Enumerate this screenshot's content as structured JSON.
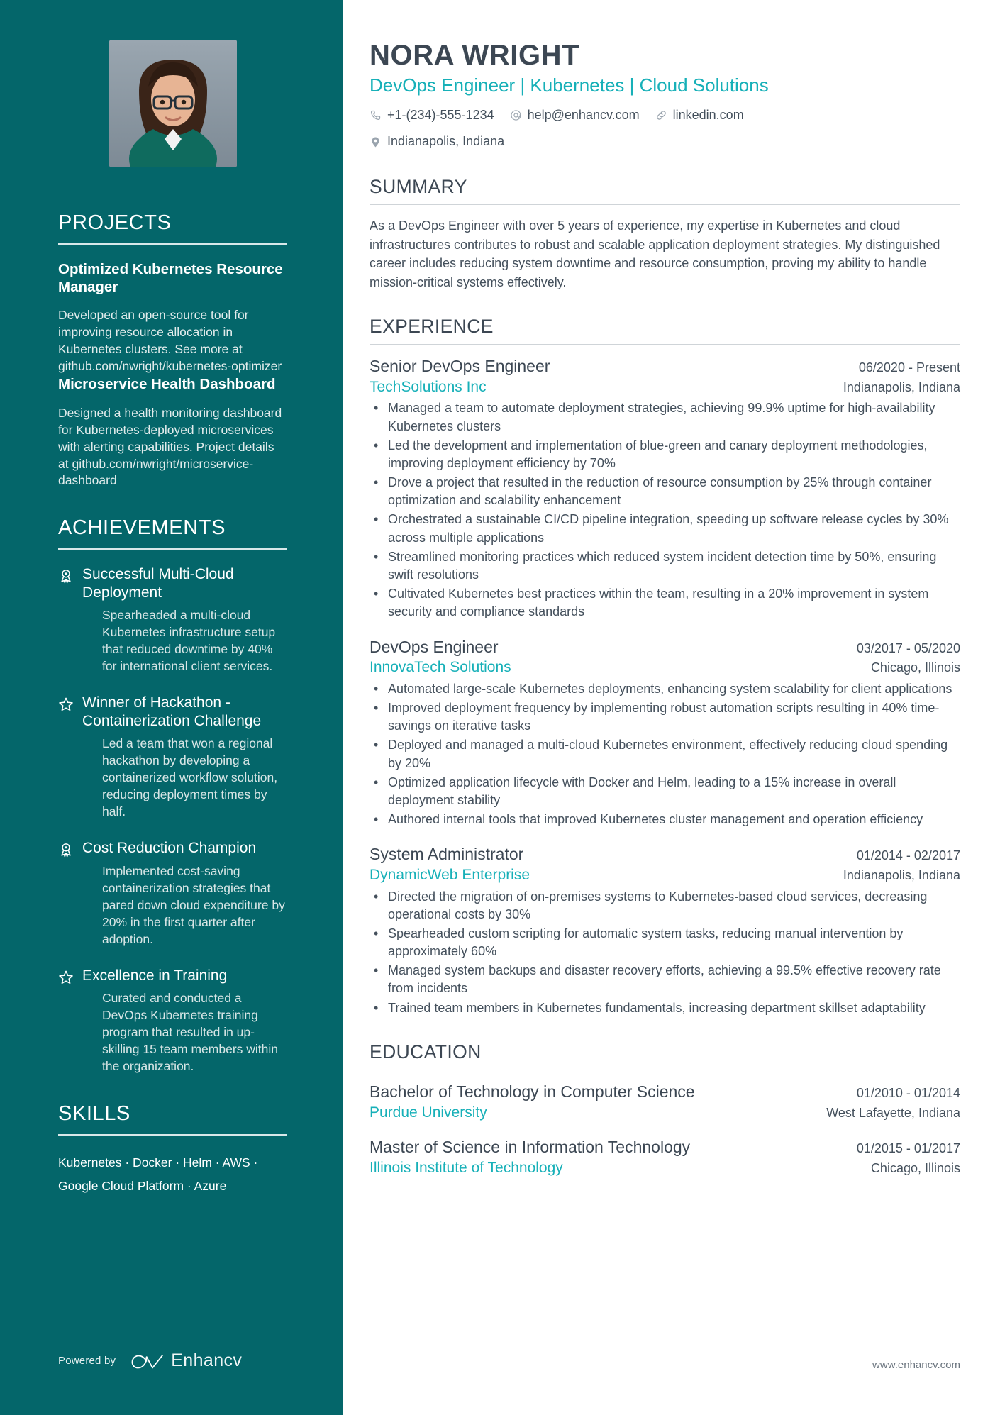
{
  "header": {
    "name": "NORA WRIGHT",
    "subtitle": "DevOps Engineer | Kubernetes | Cloud Solutions",
    "contacts": [
      {
        "icon": "phone-icon",
        "text": "+1-(234)-555-1234"
      },
      {
        "icon": "email-icon",
        "text": "help@enhancv.com"
      },
      {
        "icon": "link-icon",
        "text": "linkedin.com"
      },
      {
        "icon": "location-icon",
        "text": "Indianapolis, Indiana"
      }
    ]
  },
  "colors": {
    "sidebar_bg": "#04666a",
    "accent_teal": "#17b0b8",
    "heading_dark": "#3c4753",
    "body_text": "#44505c"
  },
  "sidebar": {
    "projects": {
      "heading": "PROJECTS",
      "items": [
        {
          "title": "Optimized Kubernetes Resource Manager",
          "description": "Developed an open-source tool for improving resource allocation in Kubernetes clusters. See more at github.com/nwright/kubernetes-optimizer"
        },
        {
          "title": "Microservice Health Dashboard",
          "description": "Designed a health monitoring dashboard for Kubernetes-deployed microservices with alerting capabilities. Project details at github.com/nwright/microservice-dashboard"
        }
      ]
    },
    "achievements": {
      "heading": "ACHIEVEMENTS",
      "items": [
        {
          "icon": "award-rosette-icon",
          "title": "Successful Multi-Cloud Deployment",
          "description": "Spearheaded a multi-cloud Kubernetes infrastructure setup that reduced downtime by 40% for international client services."
        },
        {
          "icon": "star-icon",
          "title": "Winner of Hackathon - Containerization Challenge",
          "description": "Led a team that won a regional hackathon by developing a containerized workflow solution, reducing deployment times by half."
        },
        {
          "icon": "award-rosette-icon",
          "title": "Cost Reduction Champion",
          "description": "Implemented cost-saving containerization strategies that pared down cloud expenditure by 20% in the first quarter after adoption."
        },
        {
          "icon": "star-icon",
          "title": "Excellence in Training",
          "description": "Curated and conducted a DevOps Kubernetes training program that resulted in up-skilling 15 team members within the organization."
        }
      ]
    },
    "skills": {
      "heading": "SKILLS",
      "lines": [
        "Kubernetes · Docker · Helm · AWS ·",
        "Google Cloud Platform · Azure"
      ]
    },
    "footer": {
      "powered_by": "Powered by",
      "brand": "Enhancv"
    }
  },
  "main": {
    "summary": {
      "heading": "SUMMARY",
      "text": "As a DevOps Engineer with over 5 years of experience, my expertise in Kubernetes and cloud infrastructures contributes to robust and scalable application deployment strategies. My distinguished career includes reducing system downtime and resource consumption, proving my ability to handle mission-critical systems effectively."
    },
    "experience": {
      "heading": "EXPERIENCE",
      "entries": [
        {
          "title": "Senior DevOps Engineer",
          "date": "06/2020 - Present",
          "company": "TechSolutions Inc",
          "location": "Indianapolis, Indiana",
          "bullets": [
            "Managed a team to automate deployment strategies, achieving 99.9% uptime for high-availability Kubernetes clusters",
            "Led the development and implementation of blue-green and canary deployment methodologies, improving deployment efficiency by 70%",
            "Drove a project that resulted in the reduction of resource consumption by 25% through container optimization and scalability enhancement",
            "Orchestrated a sustainable CI/CD pipeline integration, speeding up software release cycles by 30% across multiple applications",
            "Streamlined monitoring practices which reduced system incident detection time by 50%, ensuring swift resolutions",
            "Cultivated Kubernetes best practices within the team, resulting in a 20% improvement in system security and compliance standards"
          ]
        },
        {
          "title": "DevOps Engineer",
          "date": "03/2017 - 05/2020",
          "company": "InnovaTech Solutions",
          "location": "Chicago, Illinois",
          "bullets": [
            "Automated large-scale Kubernetes deployments, enhancing system scalability for client applications",
            "Improved deployment frequency by implementing robust automation scripts resulting in 40% time-savings on iterative tasks",
            "Deployed and managed a multi-cloud Kubernetes environment, effectively reducing cloud spending by 20%",
            "Optimized application lifecycle with Docker and Helm, leading to a 15% increase in overall deployment stability",
            "Authored internal tools that improved Kubernetes cluster management and operation efficiency"
          ]
        },
        {
          "title": "System Administrator",
          "date": "01/2014 - 02/2017",
          "company": "DynamicWeb Enterprise",
          "location": "Indianapolis, Indiana",
          "bullets": [
            "Directed the migration of on-premises systems to Kubernetes-based cloud services, decreasing operational costs by 30%",
            "Spearheaded custom scripting for automatic system tasks, reducing manual intervention by approximately 60%",
            "Managed system backups and disaster recovery efforts, achieving a 99.5% effective recovery rate from incidents",
            "Trained team members in Kubernetes fundamentals, increasing department skillset adaptability"
          ]
        }
      ]
    },
    "education": {
      "heading": "EDUCATION",
      "entries": [
        {
          "title": "Bachelor of Technology in Computer Science",
          "date": "01/2010 - 01/2014",
          "school": "Purdue University",
          "location": "West Lafayette, Indiana"
        },
        {
          "title": "Master of Science in Information Technology",
          "date": "01/2015 - 01/2017",
          "school": "Illinois Institute of Technology",
          "location": "Chicago, Illinois"
        }
      ]
    },
    "footer": {
      "website": "www.enhancv.com"
    }
  }
}
